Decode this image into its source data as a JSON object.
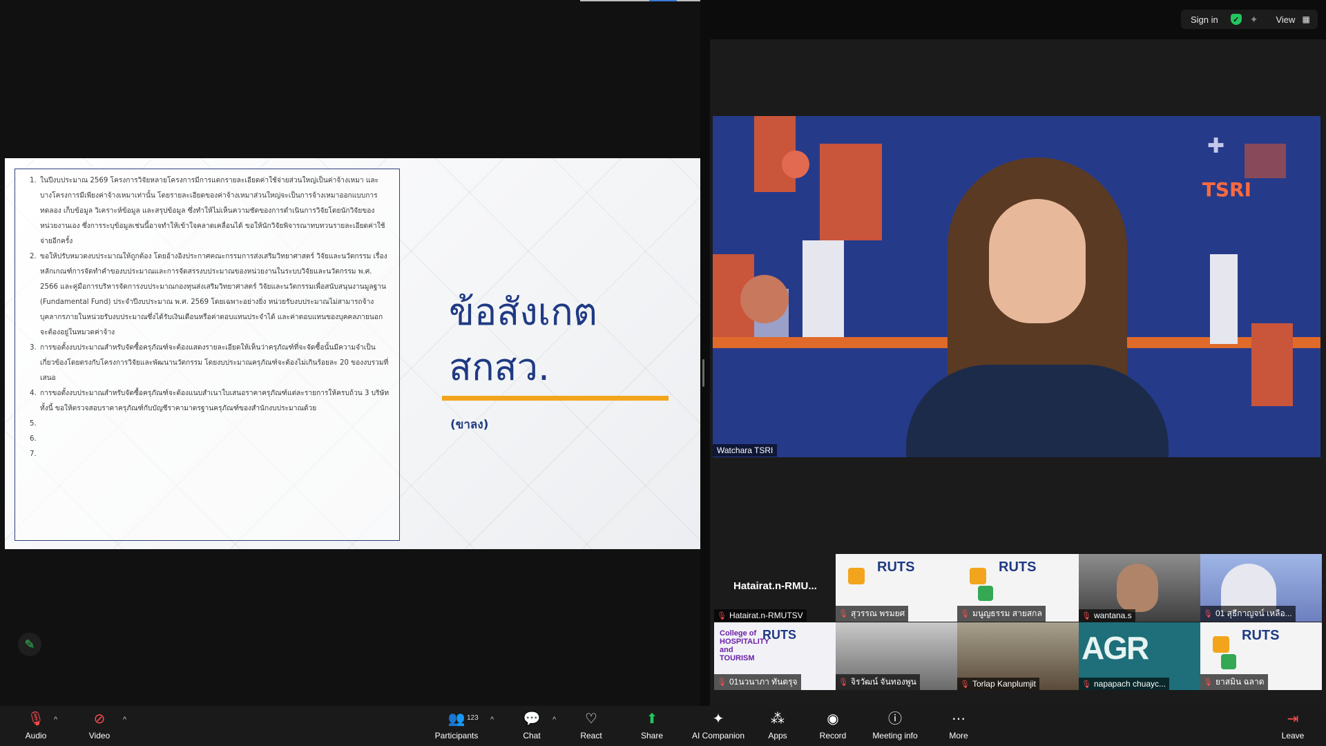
{
  "slide": {
    "title": "ข้อสังเกต สกสว.",
    "subtitle": "(ขาลง)",
    "notes": [
      "ในปีงบประมาณ 2569 โครงการวิจัยหลายโครงการมีการแตกรายละเอียดค่าใช้จ่ายส่วนใหญ่เป็นค่าจ้างเหมา และบางโครงการมีเพียงค่าจ้างเหมาเท่านั้น โดยรายละเอียดของค่าจ้างเหมาส่วนใหญ่จะเป็นการจ้างเหมาออกแบบการทดลอง เก็บข้อมูล วิเคราะห์ข้อมูล และสรุปข้อมูล ซึ่งทำให้ไม่เห็นความชัดของการดำเนินการวิจัยโดยนักวิจัยของหน่วยงานเอง ซึ่งการระบุข้อมูลเช่นนี้อาจทำให้เข้าใจคลาดเคลื่อนได้ ขอให้นักวิจัยพิจารณาทบทวนรายละเอียดค่าใช้จ่ายอีกครั้ง",
      "ขอให้ปรับหมวดงบประมาณให้ถูกต้อง โดยอ้างอิงประกาศคณะกรรมการส่งเสริมวิทยาศาสตร์ วิจัยและนวัตกรรม เรื่อง หลักเกณฑ์การจัดทำคำของบประมาณและการจัดสรรงบประมาณของหน่วยงานในระบบวิจัยและนวัตกรรม พ.ศ. 2566 และคู่มือการบริหารจัดการงบประมาณกองทุนส่งเสริมวิทยาศาสตร์ วิจัยและนวัตกรรมเพื่อสนับสนุนงานมูลฐาน (Fundamental Fund) ประจำปีงบประมาณ พ.ศ. 2569 โดยเฉพาะอย่างยิ่ง หน่วยรับงบประมาณไม่สามารถจ้างบุคลากรภายในหน่วยรับงบประมาณซึ่งได้รับเงินเดือนหรือค่าตอบแทนประจำได้ และค่าตอบแทนของบุคคลภายนอก จะต้องอยู่ในหมวดค่าจ้าง",
      "การขอตั้งงบประมาณสำหรับจัดซื้อครุภัณฑ์จะต้องแสดงรายละเอียดให้เห็นว่าครุภัณฑ์ที่จะจัดซื้อนั้นมีความจำเป็นเกี่ยวข้องโดยตรงกับโครงการวิจัยและพัฒนานวัตกรรม โดยงบประมาณครุภัณฑ์จะต้องไม่เกินร้อยละ 20 ของงบรวมที่เสนอ",
      "การขอตั้งงบประมาณสำหรับจัดซื้อครุภัณฑ์จะต้องแนบสำเนาใบเสนอราคาครุภัณฑ์แต่ละรายการให้ครบถ้วน 3 บริษัท ทั้งนี้ ขอให้ตรวจสอบราคาครุภัณฑ์กับบัญชีราคามาตรฐานครุภัณฑ์ของสำนักงบประมาณด้วย",
      "",
      "",
      ""
    ]
  },
  "speaker": {
    "name": "Watchara TSRI",
    "logo": "TSRI"
  },
  "topbar": {
    "sign_in": "Sign in",
    "view": "View"
  },
  "gallery": [
    {
      "name": "Hatairat.n-RMUTSV",
      "display": "Hatairat.n-RMU..."
    },
    {
      "name": "สุวรรณ พรมยศ"
    },
    {
      "name": "มนูญธรรม สายสกล"
    },
    {
      "name": "wantana.s"
    },
    {
      "name": "01 สุธีกาญจน์ เหลือ..."
    },
    {
      "name": "01นวนาภา ทันตรุจ"
    },
    {
      "name": "จิรวัฒน์ จันทองพูน"
    },
    {
      "name": "Torlap Kanplumjit"
    },
    {
      "name": "napapach chuayc..."
    },
    {
      "name": "ยาสมิน ฉลาด"
    }
  ],
  "tile_text": {
    "rut": "RUTS",
    "hosp_a": "College of HOSPITALITY and TOURISM",
    "agr": "AGR"
  },
  "toolbar": {
    "audio": "Audio",
    "video": "Video",
    "participants": "Participants",
    "participants_count": "123",
    "chat": "Chat",
    "react": "React",
    "share": "Share",
    "ai": "AI Companion",
    "apps": "Apps",
    "record": "Record",
    "meeting_info": "Meeting info",
    "more": "More",
    "leave": "Leave"
  },
  "colors": {
    "accent_orange": "#f2a51c",
    "slide_navy": "#1f3a83",
    "share_green": "#22c55e",
    "mute_red": "#ff4d4f"
  },
  "icons": [
    "mic-muted-icon",
    "video-off-icon",
    "participants-icon",
    "chat-icon",
    "react-icon",
    "share-icon",
    "ai-companion-icon",
    "apps-icon",
    "record-icon",
    "info-icon",
    "more-icon",
    "leave-icon",
    "shield-check-icon",
    "pencil-icon"
  ]
}
